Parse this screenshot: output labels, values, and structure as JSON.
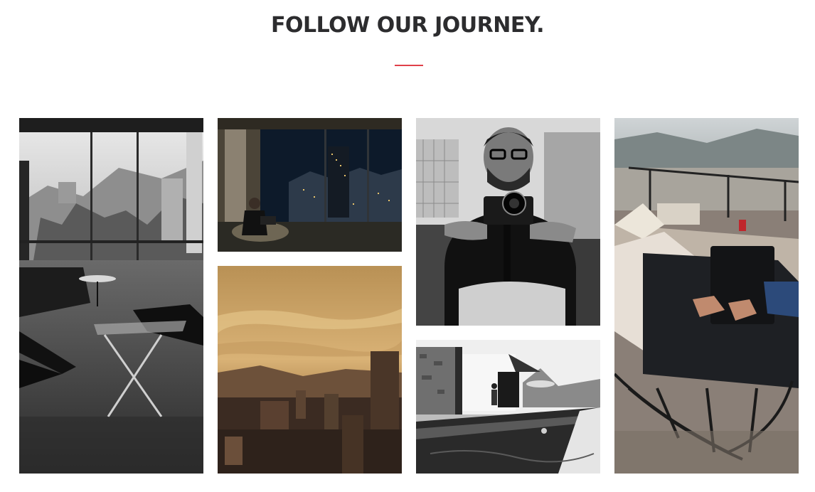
{
  "section": {
    "title": "FOLLOW OUR JOURNEY.",
    "accent_color": "#e0404a"
  },
  "gallery": {
    "photos": [
      {
        "id": "living-room-city-view",
        "tone": "grayscale"
      },
      {
        "id": "man-laptop-night-window",
        "tone": "dark color"
      },
      {
        "id": "sunset-city-skyline",
        "tone": "sepia"
      },
      {
        "id": "man-camera-gimbal",
        "tone": "grayscale"
      },
      {
        "id": "rooftop-pool",
        "tone": "grayscale"
      },
      {
        "id": "laptop-on-balcony",
        "tone": "color"
      }
    ]
  }
}
